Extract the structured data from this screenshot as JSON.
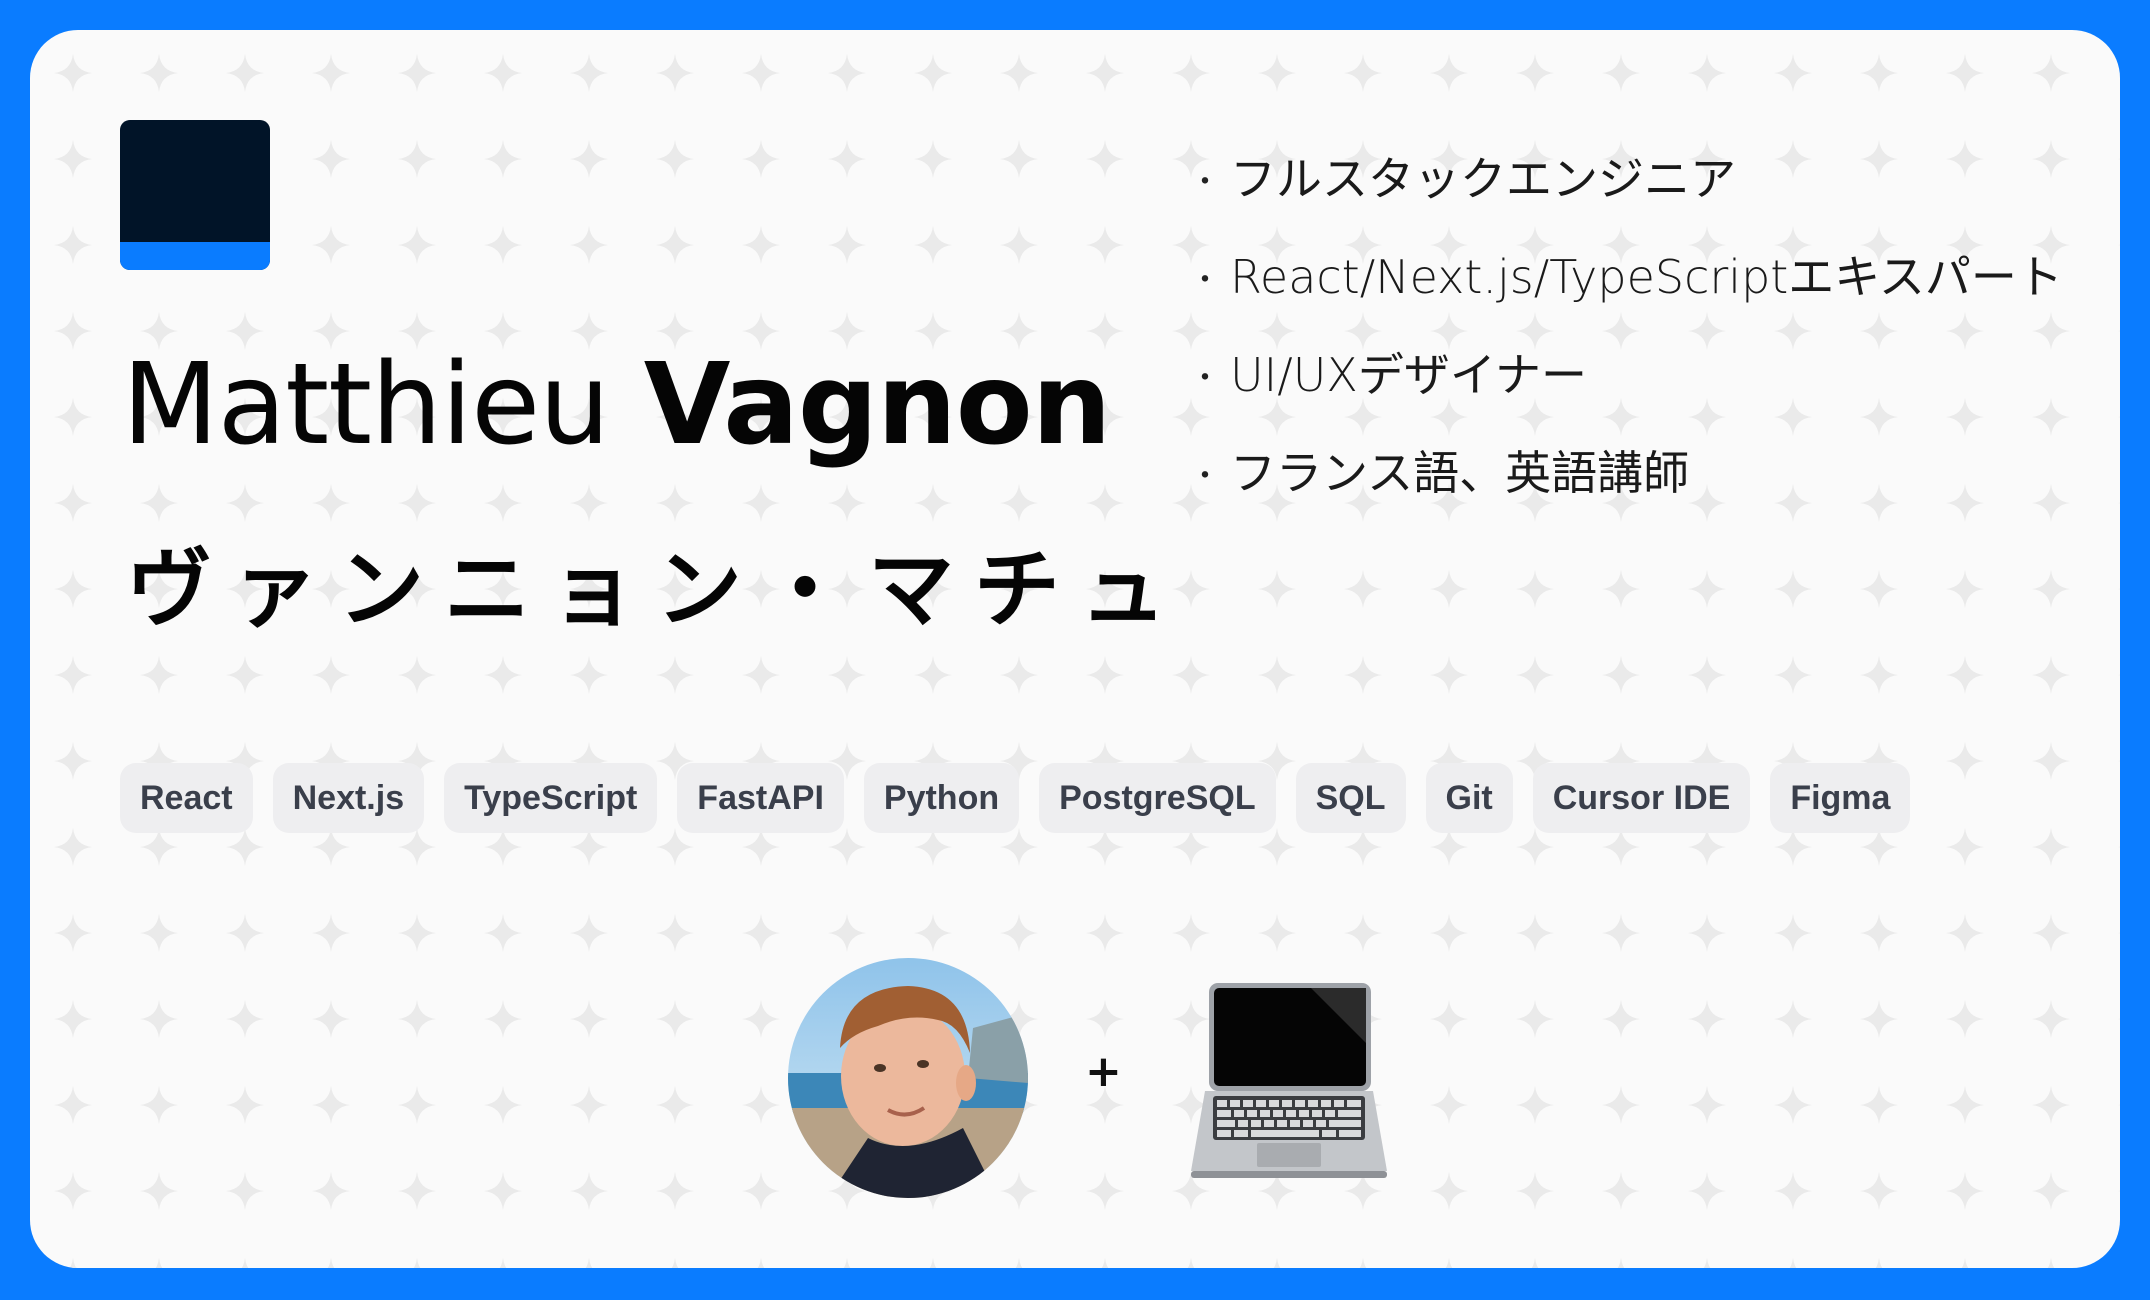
{
  "profile": {
    "first_name": "Matthieu",
    "last_name": "Vagnon",
    "name_kana": "ヴァンニョン・マチュ"
  },
  "roles": [
    "フルスタックエンジニア",
    "React/Next.js/TypeScriptエキスパート",
    "UI/UXデザイナー",
    "フランス語、英語講師"
  ],
  "bullet": "・",
  "skills": [
    "React",
    "Next.js",
    "TypeScript",
    "FastAPI",
    "Python",
    "PostgreSQL",
    "SQL",
    "Git",
    "Cursor IDE",
    "Figma"
  ],
  "footer": {
    "plus": "+",
    "avatar_icon": "person-photo-avatar",
    "laptop_icon": "laptop-icon"
  },
  "colors": {
    "frame": "#0a7cff",
    "card": "#fafafa",
    "logo_dark": "#011428",
    "logo_accent": "#0a7cff",
    "chip_bg": "#eeeef0",
    "chip_text": "#3a3f4b"
  }
}
